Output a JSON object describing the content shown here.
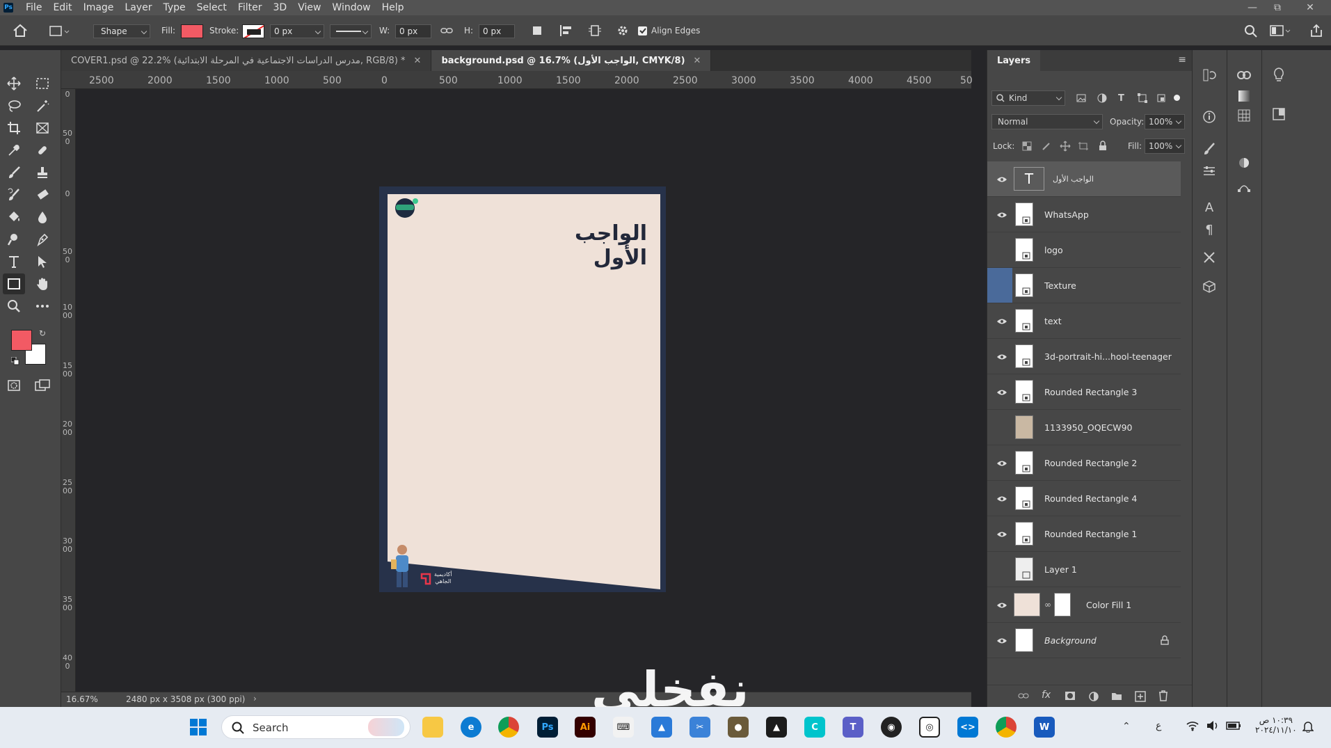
{
  "menubar": {
    "app_logo": "Ps",
    "items": [
      "File",
      "Edit",
      "Image",
      "Layer",
      "Type",
      "Select",
      "Filter",
      "3D",
      "View",
      "Window",
      "Help"
    ]
  },
  "options": {
    "mode": "Shape",
    "fill_label": "Fill:",
    "fill_color": "#f25a64",
    "stroke_label": "Stroke:",
    "stroke_width": "0 px",
    "w_label": "W:",
    "w_value": "0 px",
    "h_label": "H:",
    "h_value": "0 px",
    "align_edges": "Align Edges"
  },
  "tabs": [
    {
      "label": "COVER1.psd @ 22.2% (مدرس الدراسات الاجتماعية في المرحلة الابتدائية, RGB/8) *"
    },
    {
      "label": "background.psd @ 16.7% (الواجب الأول, CMYK/8)"
    }
  ],
  "ruler": {
    "h_labels": [
      "2500",
      "2000",
      "1500",
      "1000",
      "500",
      "0",
      "500",
      "1000",
      "1500",
      "2000",
      "2500",
      "3000",
      "3500",
      "4000",
      "4500",
      "50"
    ],
    "v_labels": [
      "0",
      "500",
      "0",
      "500",
      "1000",
      "1500",
      "2000",
      "2500",
      "3000",
      "3500",
      "400"
    ]
  },
  "document": {
    "heading": "الواجب الأول",
    "footer_brand_line1": "أكاديمية",
    "footer_brand_line2": "الجاهي"
  },
  "status": {
    "zoom": "16.67%",
    "doc_info": "2480 px x 3508 px (300 ppi)"
  },
  "layers_panel": {
    "title": "Layers",
    "filter": "Kind",
    "blend_mode": "Normal",
    "opacity_label": "Opacity:",
    "opacity_value": "100%",
    "lock_label": "Lock:",
    "fill_label": "Fill:",
    "fill_value": "100%",
    "layers": [
      {
        "name": "الواجب الأول",
        "visible": true,
        "type": "text",
        "selected": true
      },
      {
        "name": "WhatsApp",
        "visible": true,
        "type": "smart"
      },
      {
        "name": "logo",
        "visible": false,
        "type": "smart"
      },
      {
        "name": "Texture",
        "visible": false,
        "type": "smart"
      },
      {
        "name": "text",
        "visible": true,
        "type": "smart"
      },
      {
        "name": "3d-portrait-hi...hool-teenager",
        "visible": true,
        "type": "smart"
      },
      {
        "name": "Rounded Rectangle 3",
        "visible": true,
        "type": "smart"
      },
      {
        "name": "1133950_OQECW90",
        "visible": false,
        "type": "image"
      },
      {
        "name": "Rounded Rectangle 2",
        "visible": true,
        "type": "smart"
      },
      {
        "name": "Rounded Rectangle 4",
        "visible": true,
        "type": "smart"
      },
      {
        "name": "Rounded Rectangle 1",
        "visible": true,
        "type": "smart"
      },
      {
        "name": "Layer 1",
        "visible": false,
        "type": "smart"
      },
      {
        "name": "Color Fill 1",
        "visible": true,
        "type": "fill"
      },
      {
        "name": "Background",
        "visible": true,
        "type": "background"
      }
    ]
  },
  "taskbar": {
    "search_placeholder": "Search",
    "time": "١٠:٣٩ ص",
    "date": "٢٠٢٤/١١/١٠",
    "lang": "ع"
  },
  "watermark": "نفخلي",
  "colors": {
    "accent": "#f25a64",
    "panel_bg": "#474747",
    "canvas_bg": "#252528",
    "doc_navy": "#27324a",
    "page_cream": "#efe1d8"
  }
}
